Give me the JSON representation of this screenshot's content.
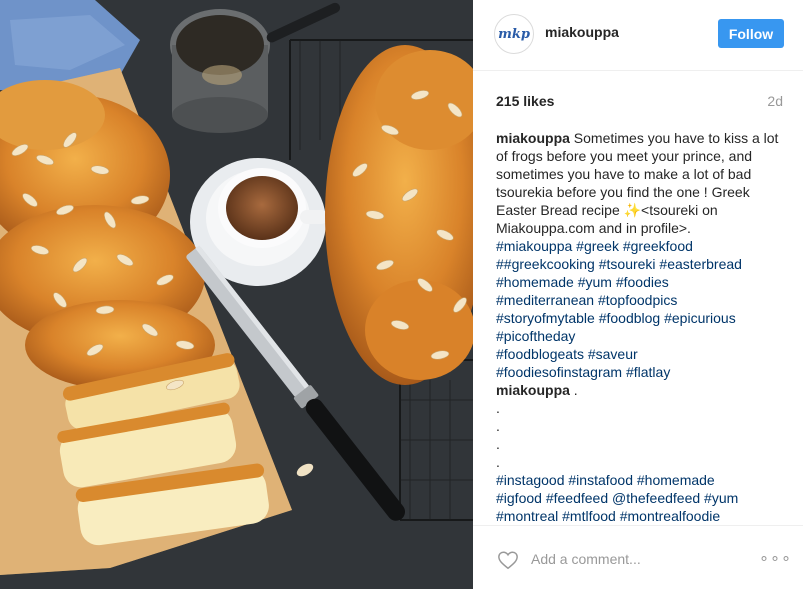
{
  "header": {
    "avatar_text": "mkp",
    "username": "miakouppa",
    "follow_label": "Follow"
  },
  "stats": {
    "likes": "215 likes",
    "age": "2d"
  },
  "caption": {
    "username": "miakouppa",
    "text": "Sometimes you have to kiss a lot of frogs before you meet your prince, and sometimes you have to make a lot of bad tsourekia before you find the one ! Greek Easter Bread recipe ✨<tsoureki on Miakouppa.com and in profile>.",
    "hashtag_lines": [
      "#miakouppa #greek #greekfood",
      "##greekcooking #tsoureki #easterbread",
      "#homemade #yum #foodies",
      "#mediterranean #topfoodpics",
      "#storyofmytable #foodblog #epicurious",
      "#picoftheday",
      "#foodblogeats #saveur",
      "#foodiesofinstagram #flatlay"
    ]
  },
  "comment": {
    "username": "miakouppa",
    "text": ".",
    "dot_lines": [
      ".",
      ".",
      ".",
      "."
    ],
    "hashtag_lines": [
      "#instagood #instafood #homemade",
      "#igfood #feedfeed @thefeedfeed #yum",
      "#montreal #mtlfood #montrealfoodie"
    ]
  },
  "footer": {
    "add_comment_placeholder": "Add a comment...",
    "more_label": "∘∘∘"
  },
  "colors": {
    "follow_button": "#3897f0",
    "hashtag": "#003569",
    "muted": "#999999"
  }
}
